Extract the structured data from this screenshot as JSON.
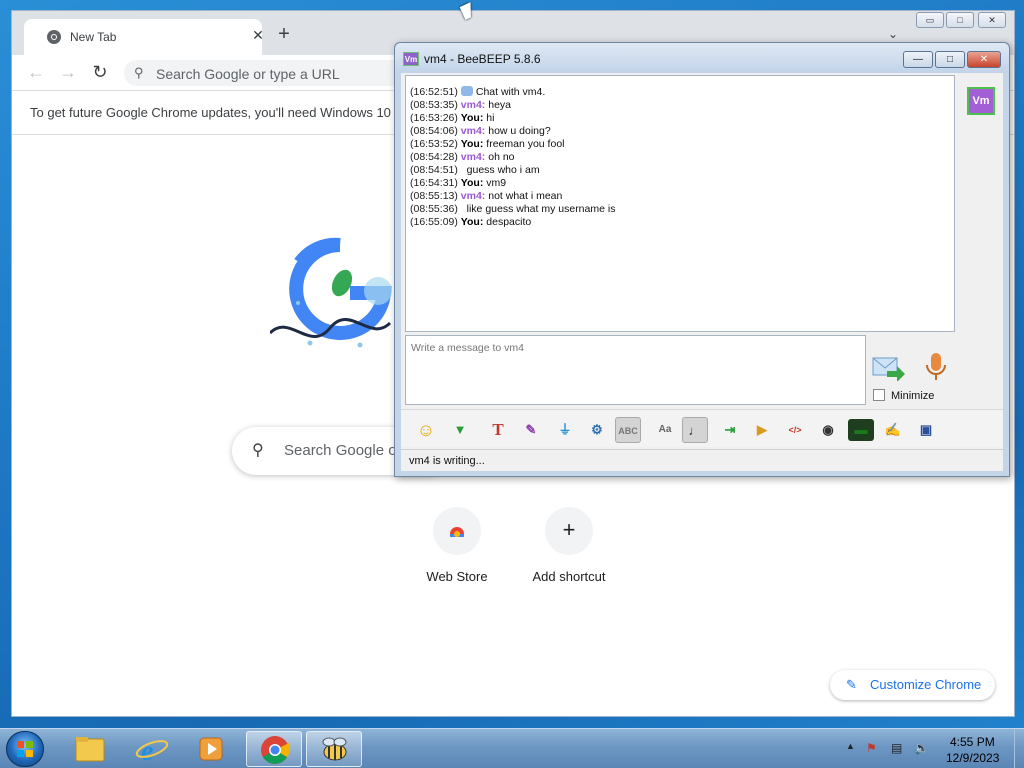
{
  "chrome": {
    "tab_title": "New Tab",
    "tab_close": "✕",
    "new_tab": "+",
    "window_controls": {
      "minimize": "▭",
      "maximize": "□",
      "close": "✕"
    },
    "omnibox_placeholder": "Search Google or type a URL",
    "infobar_text": "To get future Google Chrome updates, you'll need Windows 10",
    "search_placeholder": "Search Google o",
    "shortcuts": [
      {
        "label": "Web Store",
        "icon": "chrome-webstore-icon"
      },
      {
        "label": "Add shortcut",
        "icon": "plus-icon",
        "glyph": "+"
      }
    ],
    "customize_label": "Customize Chrome"
  },
  "beebeep": {
    "title": "vm4 - BeeBEEP 5.8.6",
    "app_icon_text": "Vm",
    "avatar_text": "Vm",
    "controls": {
      "minimize": "—",
      "maximize": "□",
      "close": "✕"
    },
    "messages": [
      {
        "time": "(16:52:51)",
        "who": "",
        "text": "Chat with vm4."
      },
      {
        "time": "(08:53:35)",
        "who": "vm4:",
        "text": " heya"
      },
      {
        "time": "(16:53:26)",
        "who": "You:",
        "text": " hi"
      },
      {
        "time": "(08:54:06)",
        "who": "vm4:",
        "text": " how u doing?"
      },
      {
        "time": "(16:53:52)",
        "who": "You:",
        "text": " freeman you fool"
      },
      {
        "time": "(08:54:28)",
        "who": "vm4:",
        "text": " oh no"
      },
      {
        "time": "(08:54:51)",
        "who": "",
        "text": "guess who i am"
      },
      {
        "time": "(16:54:31)",
        "who": "You:",
        "text": " vm9"
      },
      {
        "time": "(08:55:13)",
        "who": "vm4:",
        "text": " not what i mean"
      },
      {
        "time": "(08:55:36)",
        "who": "",
        "text": "like guess what my username is"
      },
      {
        "time": "(16:55:09)",
        "who": "You:",
        "text": " despacito"
      }
    ],
    "input_placeholder": "Write a message to vm4",
    "minimize_label": "Minimize",
    "status_text": "vm4 is writing...",
    "toolbar_icons": [
      "emoticon-icon",
      "color-icon",
      "font-icon",
      "brush-icon",
      "filter-icon",
      "settings-icon",
      "spellcheck-icon",
      "font-size-icon",
      "music-note-icon",
      "export-icon",
      "send-folder-icon",
      "html-icon",
      "screenshot-icon",
      "terminal-icon",
      "notes-icon",
      "save-icon"
    ]
  },
  "taskbar": {
    "time": "4:55 PM",
    "date": "12/9/2023"
  }
}
